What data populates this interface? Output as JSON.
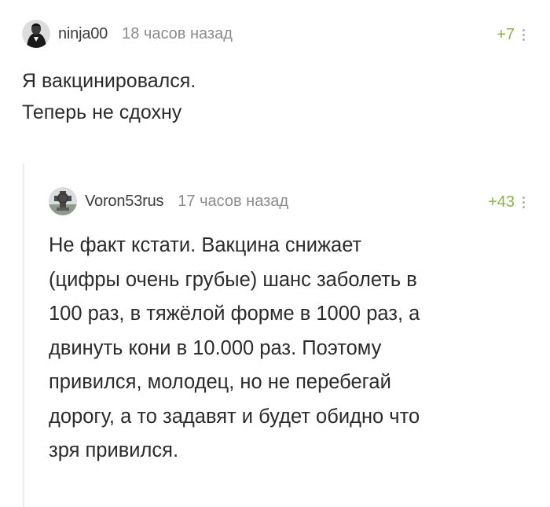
{
  "comments": [
    {
      "username": "ninja00",
      "time": "18 часов назад",
      "rating": "+7",
      "text_lines": [
        "Я вакцинировался.",
        "Теперь не сдохну"
      ]
    },
    {
      "username": "Voron53rus",
      "time": "17 часов назад",
      "rating": "+43",
      "text_lines": [
        "Не факт кстати. Вакцина снижает",
        "(цифры очень грубые) шанс заболеть в",
        "100 раз, в тяжёлой форме в 1000 раз, а",
        "двинуть кони в 10.000 раз. Поэтому",
        "привился, молодец, но не перебегай",
        "дорогу, а то задавят и будет обидно что",
        "зря привился."
      ]
    }
  ],
  "colors": {
    "rating": "#8ab34e",
    "username": "#3b3b3b",
    "time": "#8c8c8c",
    "thread_line": "#e9e9e9"
  },
  "icons": {
    "menu": "vertical-dots-icon",
    "avatar_1": "avatar",
    "avatar_2": "avatar"
  }
}
